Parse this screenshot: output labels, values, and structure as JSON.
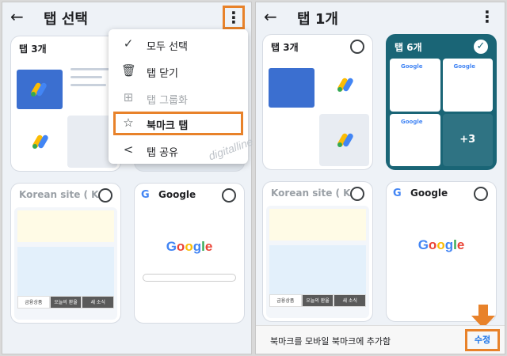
{
  "left": {
    "title": "탭 선택",
    "menu": [
      {
        "icon": "check-circle-icon",
        "glyph": "✓",
        "label": "모두 선택",
        "disabled": false
      },
      {
        "icon": "trash-icon",
        "glyph": "🗑",
        "label": "탭 닫기",
        "disabled": false
      },
      {
        "icon": "group-icon",
        "glyph": "⊞",
        "label": "탭 그룹화",
        "disabled": true
      },
      {
        "icon": "star-icon",
        "glyph": "☆",
        "label": "북마크 탭",
        "disabled": false
      },
      {
        "icon": "share-icon",
        "glyph": "<",
        "label": "탭 공유",
        "disabled": false
      }
    ],
    "cards": [
      {
        "title": "탭 3개"
      },
      {
        "title": "Korean site ( K"
      },
      {
        "title": "Google"
      }
    ]
  },
  "right": {
    "title": "탭 1개",
    "cards": [
      {
        "title": "탭 3개"
      },
      {
        "title": "탭 6개",
        "extra": "+3"
      },
      {
        "title": "Korean site ( K"
      },
      {
        "title": "Google"
      }
    ],
    "bottom_message": "북마크를 모바일 북마크에 추가함",
    "edit_label": "수정"
  },
  "watermark": "digitalline",
  "google_logo": "Google",
  "news_tabs": [
    "금융상품",
    "오늘의 환율",
    "새 소식"
  ],
  "colors": {
    "highlight": "#e8822a",
    "active_group": "#1a6576",
    "link": "#1a73e8"
  }
}
